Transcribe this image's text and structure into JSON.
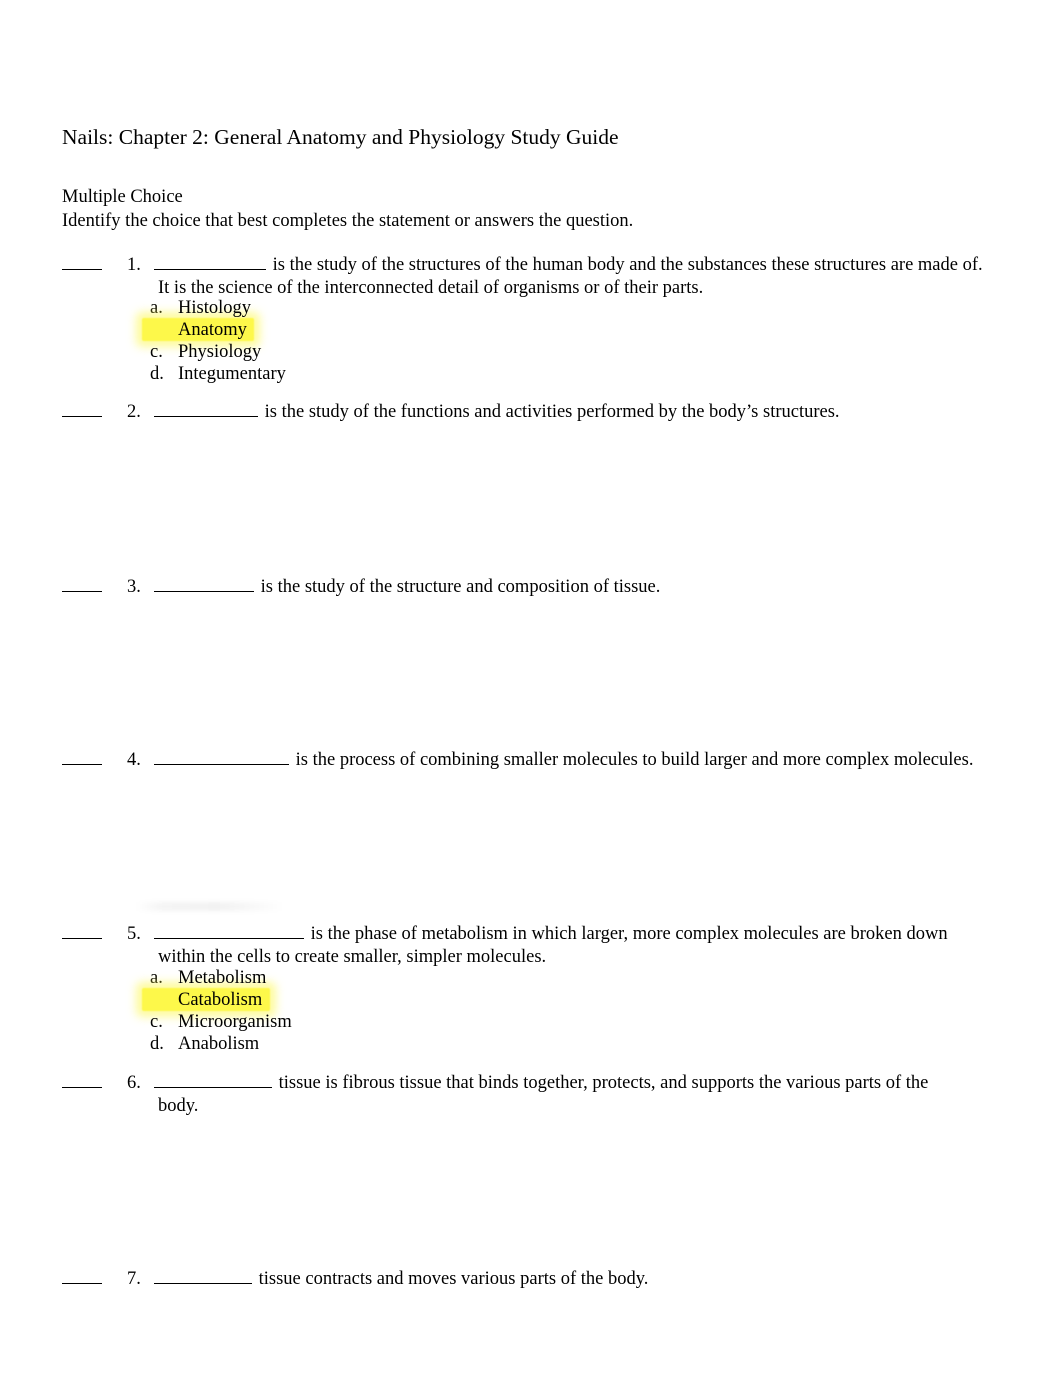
{
  "document": {
    "title": "Nails: Chapter 2: General Anatomy and Physiology Study Guide",
    "section_label": "Multiple Choice",
    "section_instructions": "Identify the choice that best completes the statement or answers the question.",
    "highlight_color": "#fdf84a"
  },
  "questions": [
    {
      "number": "1.",
      "text_before_blank": "",
      "text_after_blank": " is the study of the structures of the human body and the substances these structures are made of.",
      "continuation": "It is the science of the interconnected detail of organisms or of their parts.",
      "options": [
        {
          "letter": "a.",
          "text": "Histology",
          "highlighted": false
        },
        {
          "letter": "b.",
          "text": "Anatomy",
          "highlighted": true
        },
        {
          "letter": "c.",
          "text": "Physiology",
          "highlighted": false
        },
        {
          "letter": "d.",
          "text": "Integumentary",
          "highlighted": false
        }
      ]
    },
    {
      "number": "2.",
      "text_after_blank": " is the study of the functions and activities performed by the body’s structures.",
      "options": []
    },
    {
      "number": "3.",
      "text_after_blank": " is the study of the structure and composition of tissue.",
      "options": []
    },
    {
      "number": "4.",
      "text_after_blank": " is the process of combining smaller molecules to build larger and more complex molecules.",
      "options": []
    },
    {
      "number": "5.",
      "text_after_blank": " is the phase of metabolism in which larger, more complex molecules are broken down",
      "continuation": "within the cells to create smaller, simpler molecules.",
      "options": [
        {
          "letter": "a.",
          "text": "Metabolism",
          "highlighted": false
        },
        {
          "letter": "b.",
          "text": "Catabolism",
          "highlighted": true
        },
        {
          "letter": "c.",
          "text": "Microorganism",
          "highlighted": false
        },
        {
          "letter": "d.",
          "text": "Anabolism",
          "highlighted": false
        }
      ]
    },
    {
      "number": "6.",
      "text_after_blank": " tissue is fibrous tissue that binds together, protects, and supports the various parts of the",
      "continuation": "body.",
      "options": []
    },
    {
      "number": "7.",
      "text_after_blank": " tissue contracts and moves various parts of the body.",
      "options": []
    }
  ]
}
